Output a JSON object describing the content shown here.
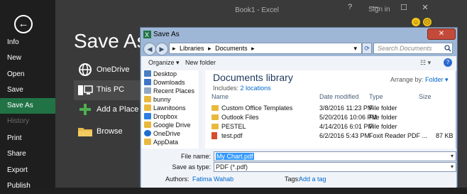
{
  "backstage": {
    "back_icon": "←",
    "title": "Save As",
    "window_title": "Book1 - Excel",
    "sign_in": "Sign in",
    "help": "?",
    "minimize": "—",
    "maximize": "☐",
    "close": "✕",
    "menu": [
      "Info",
      "New",
      "Open",
      "Save",
      "Save As",
      "History",
      "Print",
      "Share",
      "Export",
      "Publish"
    ],
    "active_menu": "Save As",
    "locations": [
      "OneDrive",
      "This PC",
      "Add a Place",
      "Browse"
    ],
    "accent_color": "#217346"
  },
  "dialog": {
    "title": "Save As",
    "close_glyph": "✕",
    "address": [
      "Libraries",
      "Documents"
    ],
    "search_placeholder": "Search Documents",
    "toolbar": {
      "organize": "Organize ▾",
      "new_folder": "New folder"
    },
    "nav_items": [
      "Desktop",
      "Downloads",
      "Recent Places",
      "bunny",
      "Lawnitoons",
      "Dropbox",
      "Google Drive",
      "OneDrive",
      "AppData"
    ],
    "library": {
      "title": "Documents library",
      "includes_label": "Includes:",
      "includes_link": "2 locations",
      "arrange_label": "Arrange by:",
      "arrange_value": "Folder ▾"
    },
    "columns": [
      "Name",
      "Date modified",
      "Type",
      "Size"
    ],
    "files": [
      {
        "name": "Custom Office Templates",
        "date": "3/8/2016 11:23 PM",
        "type": "File folder",
        "size": "",
        "kind": "folder"
      },
      {
        "name": "Outlook Files",
        "date": "5/20/2016 10:06 PM",
        "type": "File folder",
        "size": "",
        "kind": "folder"
      },
      {
        "name": "PESTEL",
        "date": "4/14/2016 6:01 PM",
        "type": "File folder",
        "size": "",
        "kind": "folder"
      },
      {
        "name": "test.pdf",
        "date": "6/2/2016 5:43 PM",
        "type": "Foxit Reader PDF ...",
        "size": "87 KB",
        "kind": "pdf"
      }
    ],
    "form": {
      "filename_label": "File name:",
      "filename_value": "My Chart.pdf",
      "savetype_label": "Save as type:",
      "savetype_value": "PDF (*.pdf)",
      "authors_label": "Authors:",
      "authors_value": "Fatima Wahab",
      "tags_label": "Tags:",
      "tags_value": "Add a tag"
    }
  }
}
